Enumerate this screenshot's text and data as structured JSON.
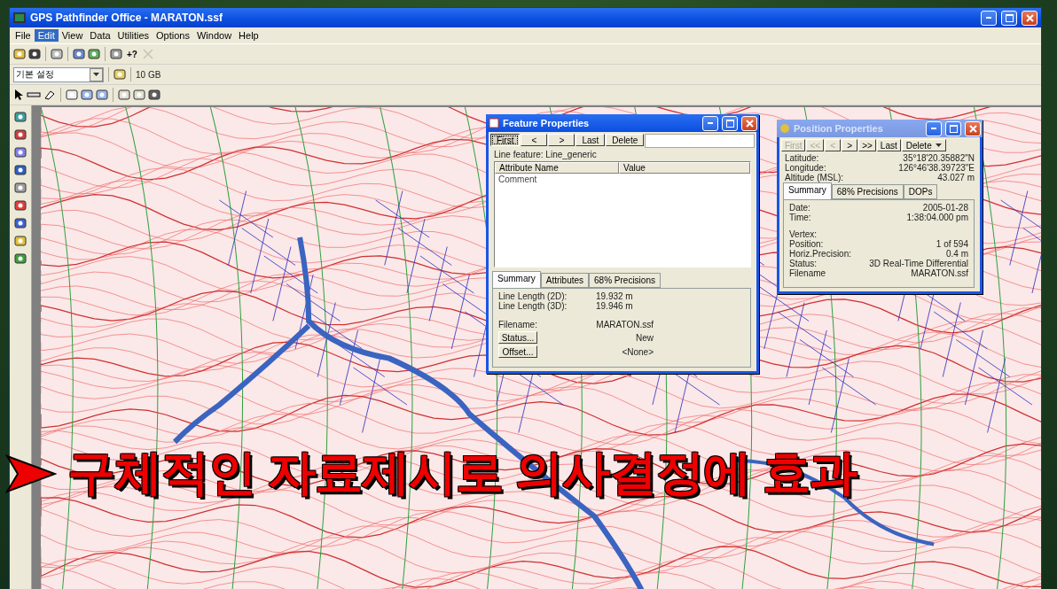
{
  "window": {
    "title": "GPS Pathfinder Office - MARATON.ssf"
  },
  "menu": [
    {
      "label": "File",
      "selected": false
    },
    {
      "label": "Edit",
      "selected": true
    },
    {
      "label": "View",
      "selected": false
    },
    {
      "label": "Data",
      "selected": false
    },
    {
      "label": "Utilities",
      "selected": false
    },
    {
      "label": "Options",
      "selected": false
    },
    {
      "label": "Window",
      "selected": false
    },
    {
      "label": "Help",
      "selected": false
    }
  ],
  "toolbar": {
    "help_label": "+?",
    "profile": "기본 설정",
    "storage": "10 GB"
  },
  "feature_properties": {
    "title": "Feature Properties",
    "nav": [
      {
        "label": "First",
        "pressed": true
      },
      {
        "label": "<",
        "pressed": false
      },
      {
        "label": ">",
        "pressed": false
      },
      {
        "label": "Last",
        "pressed": false
      },
      {
        "label": "Delete",
        "pressed": false
      }
    ],
    "feature_line": "Line feature: Line_generic",
    "columns": [
      "Attribute Name",
      "Value"
    ],
    "rows": [
      "Comment"
    ],
    "tabs": [
      {
        "label": "Summary",
        "selected": true
      },
      {
        "label": "Attributes",
        "selected": false
      },
      {
        "label": "68% Precisions",
        "selected": false
      }
    ],
    "fields": [
      {
        "label": "Line Length (2D):",
        "value": "19.932 m"
      },
      {
        "label": "Line Length (3D):",
        "value": "19.946 m"
      }
    ],
    "filename": {
      "label": "Filename:",
      "value": "MARATON.ssf"
    },
    "buttons": [
      {
        "label": "Status...",
        "value": "New"
      },
      {
        "label": "Offset...",
        "value": "<None>"
      }
    ]
  },
  "position_properties": {
    "title": "Position Properties",
    "nav": [
      {
        "label": "First",
        "disabled": true
      },
      {
        "label": "<<",
        "disabled": true
      },
      {
        "label": "<",
        "disabled": true
      },
      {
        "label": ">",
        "disabled": false
      },
      {
        "label": ">>",
        "disabled": false
      },
      {
        "label": "Last",
        "disabled": false
      },
      {
        "label": "Delete",
        "disabled": false
      }
    ],
    "coords": [
      {
        "label": "Latitude:",
        "value": "35°18'20.35882\"N"
      },
      {
        "label": "Longitude:",
        "value": "126°46'38.39723\"E"
      },
      {
        "label": "Altitude (MSL):",
        "value": "43.027 m"
      }
    ],
    "tabs": [
      {
        "label": "Summary",
        "selected": true
      },
      {
        "label": "68% Precisions",
        "selected": false
      },
      {
        "label": "DOPs",
        "selected": false
      }
    ],
    "groups": [
      [
        {
          "label": "Date:",
          "value": "2005-01-28"
        },
        {
          "label": "Time:",
          "value": "1:38:04.000 pm"
        }
      ],
      [
        {
          "label": "Vertex:"
        },
        {
          "label": "Position:",
          "value": "1 of 594"
        },
        {
          "label": "Horiz.Precision:",
          "value": "0.4 m"
        },
        {
          "label": "Status:",
          "value": "3D Real-Time Differential"
        },
        {
          "label": "Filename",
          "value": "MARATON.ssf"
        }
      ]
    ]
  },
  "caption": "구체적인 자료제시로 의사결정에 효과"
}
